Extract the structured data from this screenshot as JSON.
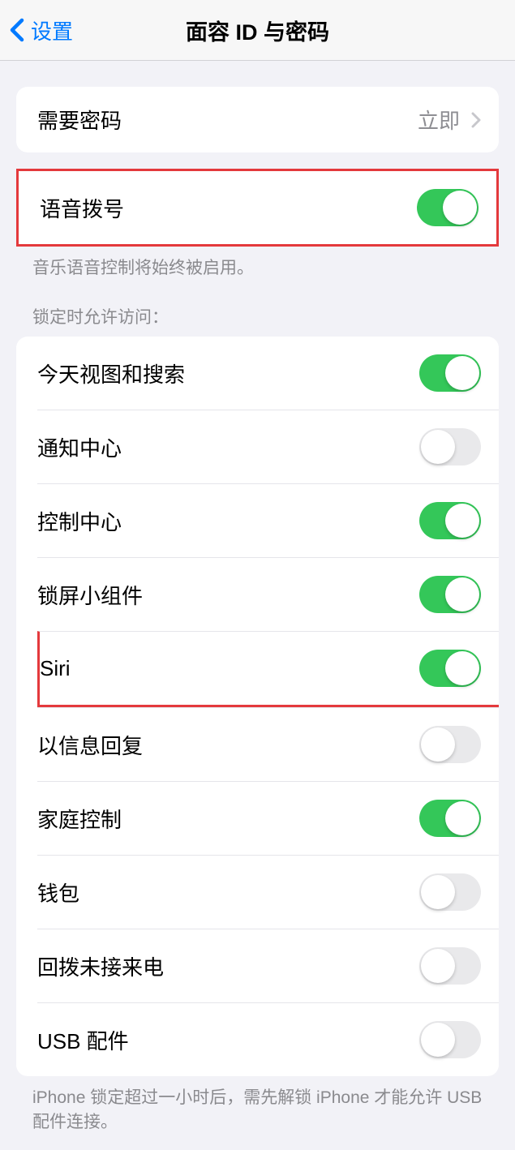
{
  "nav": {
    "back": "设置",
    "title": "面容 ID 与密码"
  },
  "require_passcode": {
    "label": "需要密码",
    "value": "立即"
  },
  "voice_dial": {
    "label": "语音拨号",
    "on": true,
    "footer": "音乐语音控制将始终被启用。"
  },
  "access_header": "锁定时允许访问：",
  "access_items": [
    {
      "label": "今天视图和搜索",
      "on": true
    },
    {
      "label": "通知中心",
      "on": false
    },
    {
      "label": "控制中心",
      "on": true
    },
    {
      "label": "锁屏小组件",
      "on": true
    },
    {
      "label": "Siri",
      "on": true,
      "highlighted": true
    },
    {
      "label": "以信息回复",
      "on": false
    },
    {
      "label": "家庭控制",
      "on": true
    },
    {
      "label": "钱包",
      "on": false
    },
    {
      "label": "回拨未接来电",
      "on": false
    },
    {
      "label": "USB 配件",
      "on": false
    }
  ],
  "usb_footer": "iPhone 锁定超过一小时后，需先解锁 iPhone 才能允许 USB 配件连接。"
}
